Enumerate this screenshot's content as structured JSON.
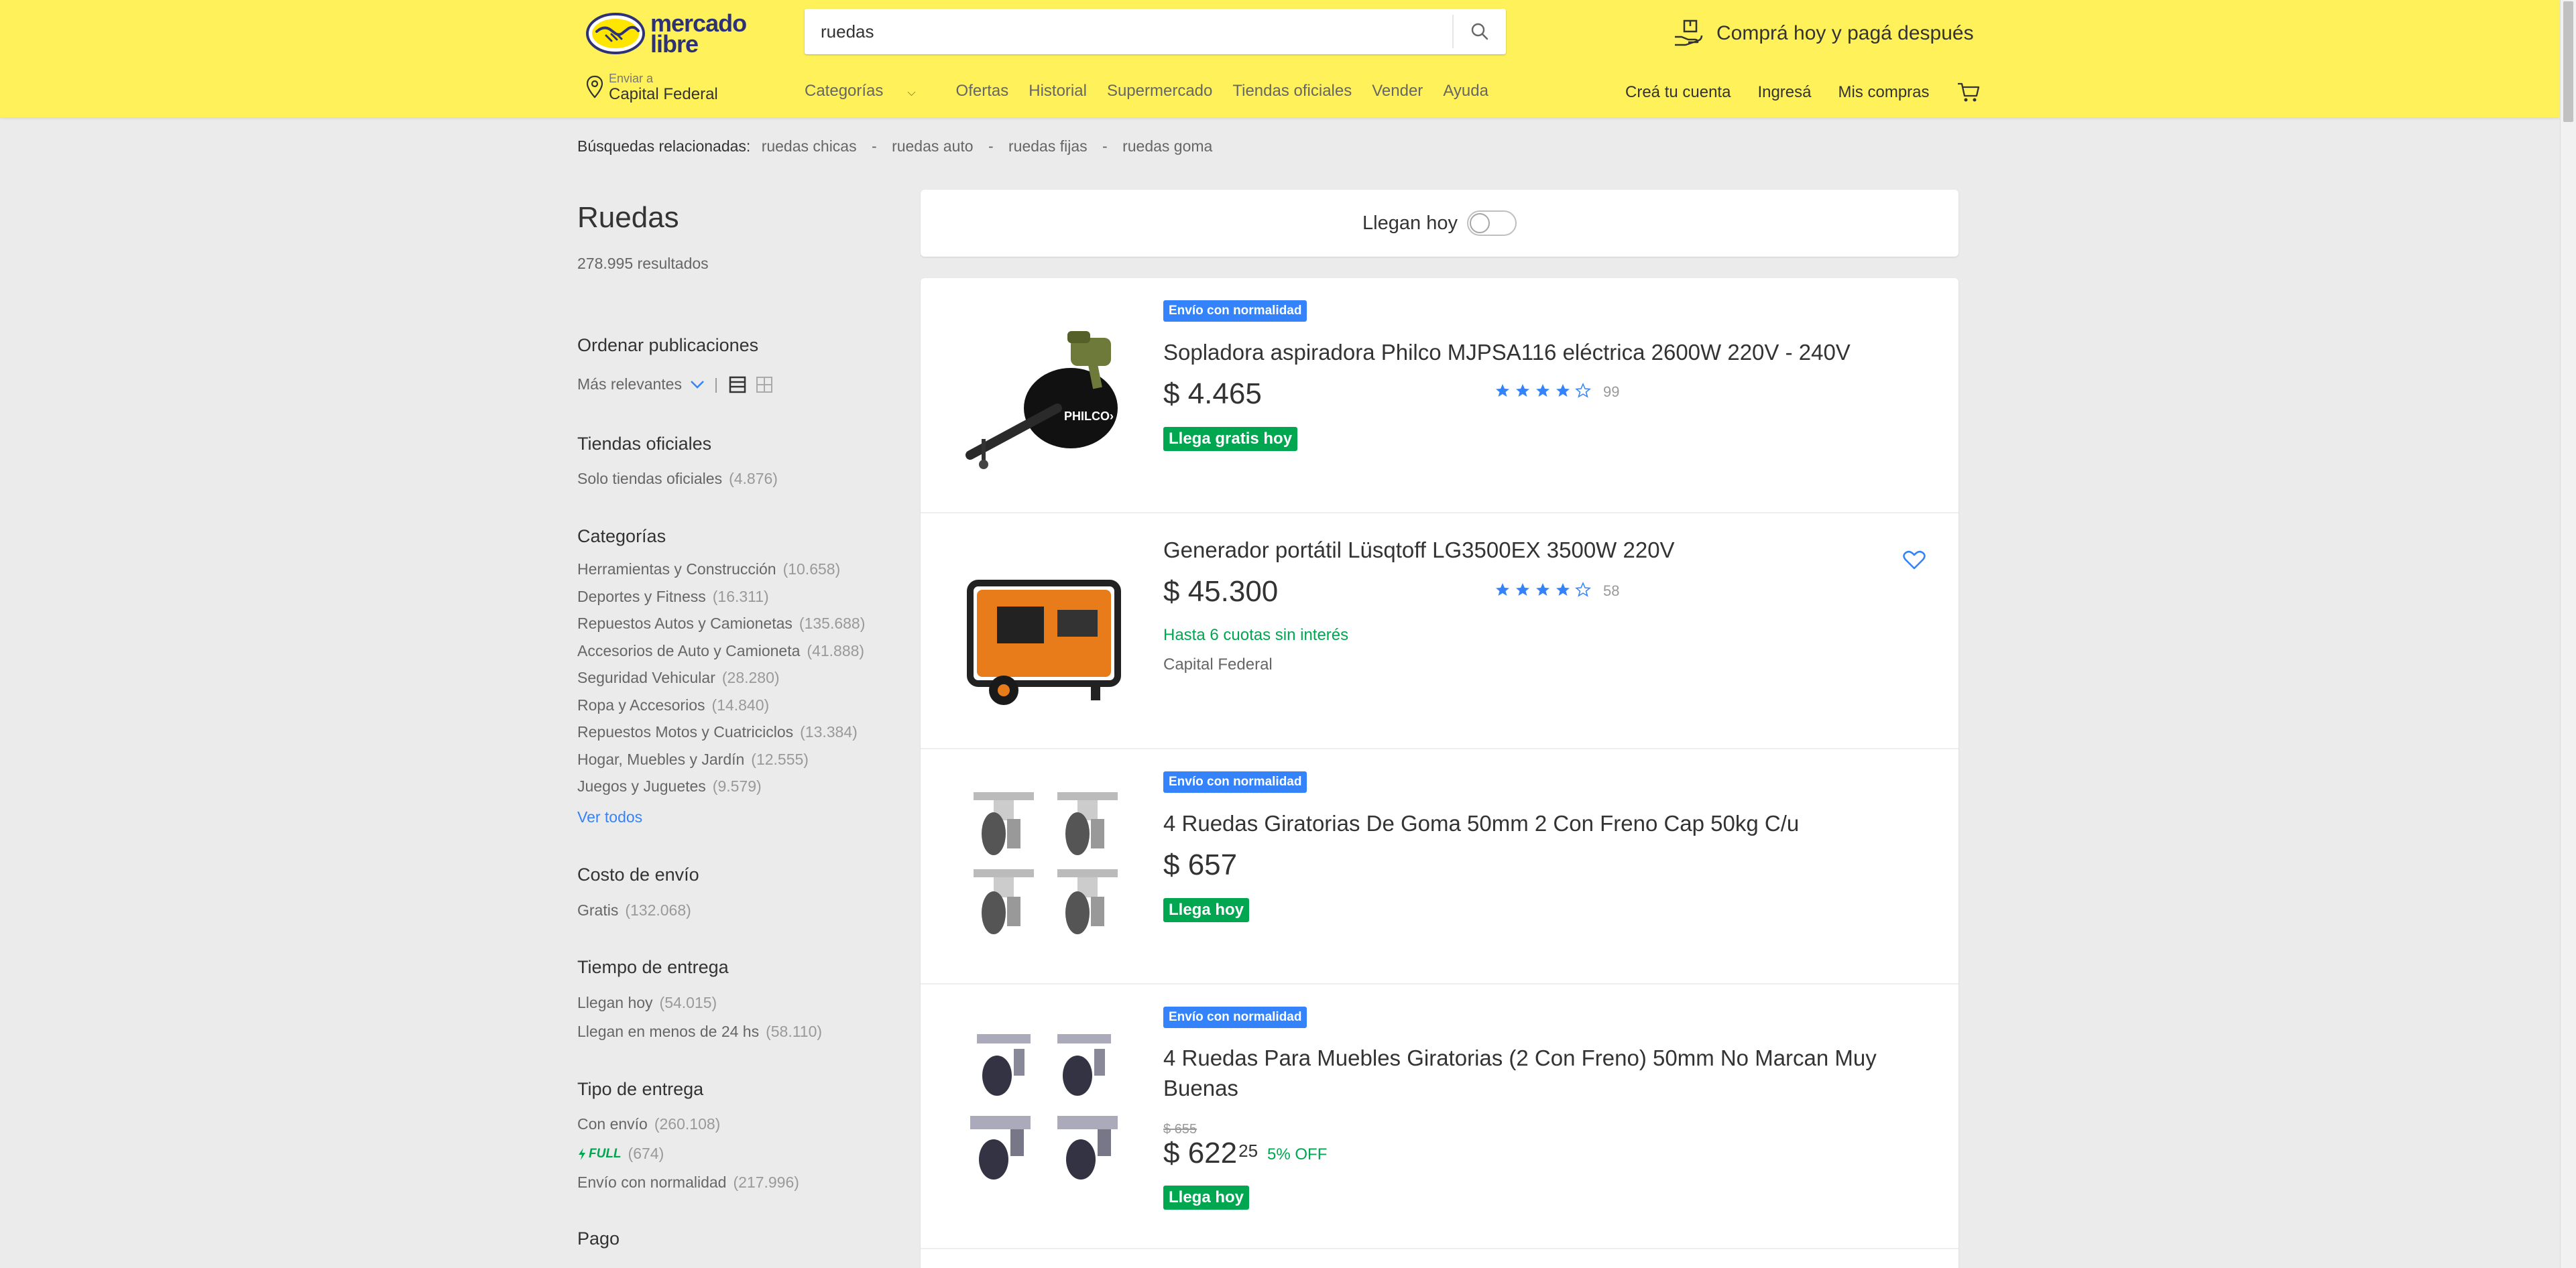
{
  "header": {
    "logo": {
      "line1": "mercado",
      "line2": "libre"
    },
    "search": {
      "value": "ruedas"
    },
    "promo": "Comprá hoy y pagá después",
    "location": {
      "label": "Enviar a",
      "value": "Capital Federal"
    },
    "nav": [
      "Categorías",
      "Ofertas",
      "Historial",
      "Supermercado",
      "Tiendas oficiales",
      "Vender",
      "Ayuda"
    ],
    "user_nav": [
      "Creá tu cuenta",
      "Ingresá",
      "Mis compras"
    ]
  },
  "related": {
    "label": "Búsquedas relacionadas:",
    "items": [
      "ruedas chicas",
      "ruedas auto",
      "ruedas fijas",
      "ruedas goma"
    ]
  },
  "sidebar": {
    "title": "Ruedas",
    "count": "278.995 resultados",
    "sort": {
      "heading": "Ordenar publicaciones",
      "value": "Más relevantes"
    },
    "official": {
      "heading": "Tiendas oficiales",
      "items": [
        {
          "label": "Solo tiendas oficiales",
          "n": "(4.876)"
        }
      ]
    },
    "categories": {
      "heading": "Categorías",
      "items": [
        {
          "label": "Herramientas y Construcción",
          "n": "(10.658)"
        },
        {
          "label": "Deportes y Fitness",
          "n": "(16.311)"
        },
        {
          "label": "Repuestos Autos y Camionetas",
          "n": "(135.688)"
        },
        {
          "label": "Accesorios de Auto y Camioneta",
          "n": "(41.888)"
        },
        {
          "label": "Seguridad Vehicular",
          "n": "(28.280)"
        },
        {
          "label": "Ropa y Accesorios",
          "n": "(14.840)"
        },
        {
          "label": "Repuestos Motos y Cuatriciclos",
          "n": "(13.384)"
        },
        {
          "label": "Hogar, Muebles y Jardín",
          "n": "(12.555)"
        },
        {
          "label": "Juegos y Juguetes",
          "n": "(9.579)"
        }
      ],
      "see_all": "Ver todos"
    },
    "shipping_cost": {
      "heading": "Costo de envío",
      "items": [
        {
          "label": "Gratis",
          "n": "(132.068)"
        }
      ]
    },
    "delivery_time": {
      "heading": "Tiempo de entrega",
      "items": [
        {
          "label": "Llegan hoy",
          "n": "(54.015)"
        },
        {
          "label": "Llegan en menos de 24 hs",
          "n": "(58.110)"
        }
      ]
    },
    "delivery_type": {
      "heading": "Tipo de entrega",
      "items": [
        {
          "label": "Con envío",
          "n": "(260.108)"
        },
        {
          "label": "FULL",
          "n": "(674)"
        },
        {
          "label": "Envío con normalidad",
          "n": "(217.996)"
        }
      ]
    },
    "payment": {
      "heading": "Pago"
    }
  },
  "toggle": {
    "label": "Llegan hoy",
    "on": false
  },
  "products": [
    {
      "badge": "Envío con normalidad",
      "title": "Sopladora aspiradora Philco MJPSA116 eléctrica 2600W 220V - 240V",
      "price": "$ 4.465",
      "rating": 4.5,
      "reviews": "99",
      "shipping": "Llega gratis hoy",
      "image_brand": "PHILCO›"
    },
    {
      "title": "Generador portátil Lüsqtoff LG3500EX 3500W 220V",
      "price": "$ 45.300",
      "rating": 4.5,
      "reviews": "58",
      "installments": "Hasta 6 cuotas sin interés",
      "location": "Capital Federal"
    },
    {
      "badge": "Envío con normalidad",
      "title": "4 Ruedas Giratorias De Goma 50mm 2 Con Freno Cap 50kg C/u",
      "price": "$ 657",
      "shipping": "Llega hoy"
    },
    {
      "badge": "Envío con normalidad",
      "title": "4 Ruedas Para Muebles Giratorias (2 Con Freno) 50mm No Marcan Muy Buenas",
      "old_price": "$ 655",
      "price": "$ 622",
      "cents": "25",
      "discount": "5% OFF",
      "shipping": "Llega hoy"
    }
  ],
  "colors": {
    "header": "#fff159",
    "accent": "#3483fa",
    "green": "#00a650",
    "bg": "#ebebeb"
  }
}
